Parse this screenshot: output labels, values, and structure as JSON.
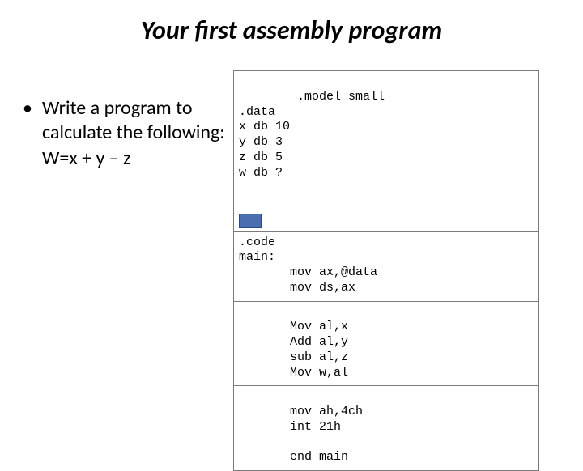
{
  "title": "Your first assembly program",
  "left": {
    "bullet_dot": "•",
    "line1": "Write a program to calculate the following:",
    "line2": "W=x + y – z"
  },
  "code": {
    "cell1": ".model small\n.data\nx db 10\ny db 3\nz db 5\nw db ?\n",
    "cell2": ".code\nmain:\n       mov ax,@data\n       mov ds,ax",
    "cell3": "\n       Mov al,x\n       Add al,y\n       sub al,z\n       Mov w,al",
    "cell4": "\n       mov ah,4ch\n       int 21h\n\n       end main"
  }
}
